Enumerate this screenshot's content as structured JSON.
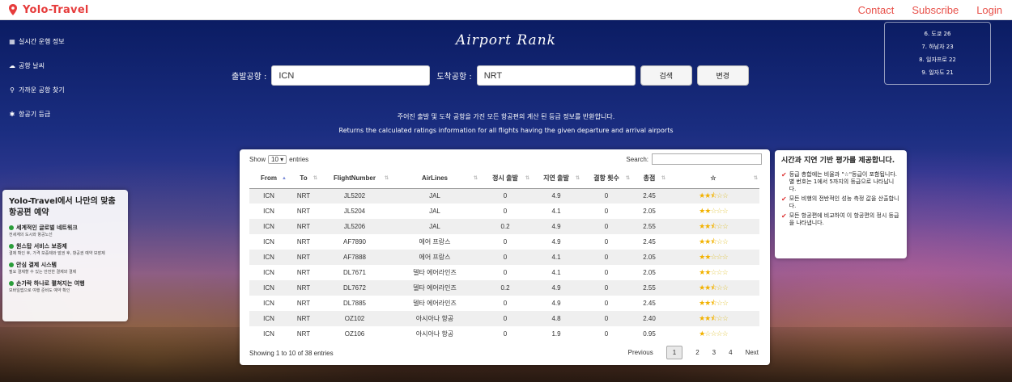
{
  "brand": {
    "name": "Yolo-Travel"
  },
  "nav": {
    "contact": "Contact",
    "subscribe": "Subscribe",
    "login": "Login"
  },
  "sidemenu": [
    {
      "icon": "card-icon",
      "label": "실시간 운행 정보"
    },
    {
      "icon": "cloud-icon",
      "label": "공항 날씨"
    },
    {
      "icon": "search-icon",
      "label": "가까운 공항 찾기"
    },
    {
      "icon": "star-icon",
      "label": "항공기 등급"
    }
  ],
  "title": "Airport Rank",
  "search": {
    "departure_label": "출발공항 :",
    "departure_value": "ICN",
    "arrival_label": "도착공항 :",
    "arrival_value": "NRT",
    "search_button": "검색",
    "swap_button": "변경"
  },
  "rank_box": [
    "6. 도쿄 26",
    "7. 하남자 23",
    "8. 일자프로 22",
    "9. 일자도 21"
  ],
  "description": {
    "korean": "주어진 출발 및 도착 공항을 가진 모든 항공편의 계산 된 등급 정보를 반환합니다.",
    "english": "Returns the calculated ratings information for all flights having the given departure and arrival airports"
  },
  "table": {
    "show_label": "Show",
    "entries_value": "10",
    "entries_label": "entries",
    "search_label": "Search:",
    "columns": [
      "From",
      "To",
      "FlightNumber",
      "AirLines",
      "정시 출발",
      "지연 출발",
      "결항 횟수",
      "총점",
      "☆"
    ],
    "rows": [
      {
        "from": "ICN",
        "to": "NRT",
        "flight": "JL5202",
        "airline": "JAL",
        "ontime": "0",
        "delay": "4.9",
        "cancel": "0",
        "score": "2.45",
        "stars": 2.5
      },
      {
        "from": "ICN",
        "to": "NRT",
        "flight": "JL5204",
        "airline": "JAL",
        "ontime": "0",
        "delay": "4.1",
        "cancel": "0",
        "score": "2.05",
        "stars": 2
      },
      {
        "from": "ICN",
        "to": "NRT",
        "flight": "JL5206",
        "airline": "JAL",
        "ontime": "0.2",
        "delay": "4.9",
        "cancel": "0",
        "score": "2.55",
        "stars": 2.5
      },
      {
        "from": "ICN",
        "to": "NRT",
        "flight": "AF7890",
        "airline": "에어 프랑스",
        "ontime": "0",
        "delay": "4.9",
        "cancel": "0",
        "score": "2.45",
        "stars": 2.5
      },
      {
        "from": "ICN",
        "to": "NRT",
        "flight": "AF7888",
        "airline": "에어 프랑스",
        "ontime": "0",
        "delay": "4.1",
        "cancel": "0",
        "score": "2.05",
        "stars": 2
      },
      {
        "from": "ICN",
        "to": "NRT",
        "flight": "DL7671",
        "airline": "델타 에어라인즈",
        "ontime": "0",
        "delay": "4.1",
        "cancel": "0",
        "score": "2.05",
        "stars": 2
      },
      {
        "from": "ICN",
        "to": "NRT",
        "flight": "DL7672",
        "airline": "델타 에어라인즈",
        "ontime": "0.2",
        "delay": "4.9",
        "cancel": "0",
        "score": "2.55",
        "stars": 2.5
      },
      {
        "from": "ICN",
        "to": "NRT",
        "flight": "DL7885",
        "airline": "델타 에어라인즈",
        "ontime": "0",
        "delay": "4.9",
        "cancel": "0",
        "score": "2.45",
        "stars": 2.5
      },
      {
        "from": "ICN",
        "to": "NRT",
        "flight": "OZ102",
        "airline": "아시아나 항공",
        "ontime": "0",
        "delay": "4.8",
        "cancel": "0",
        "score": "2.40",
        "stars": 2.5
      },
      {
        "from": "ICN",
        "to": "NRT",
        "flight": "OZ106",
        "airline": "아시아나 항공",
        "ontime": "0",
        "delay": "1.9",
        "cancel": "0",
        "score": "0.95",
        "stars": 1
      }
    ],
    "info": "Showing 1 to 10 of 38 entries",
    "pager": {
      "previous": "Previous",
      "pages": [
        "1",
        "2",
        "3",
        "4"
      ],
      "next": "Next"
    }
  },
  "right_card": {
    "heading": "시간과 지연 기반 평가를 제공합니다.",
    "items": [
      "등급 총합에는 비율과 \"☆\"등급이 포함됩니다. 별 번호는 1에서 5까지의 등급으로 나타납니다.",
      "모든 비행의 전반적인 성능 측정 값을 산출합니다.",
      "모든 항공편에 비교하여 이 항공편의 정시 등급을 나타냅니다."
    ]
  },
  "left_card": {
    "heading": "Yolo-Travel에서 나만의 맞춤 항공편 예약",
    "features": [
      {
        "title": "세계적인 글로벌 네트워크",
        "sub": "전세계의 도시와 항공노선"
      },
      {
        "title": "원스탑 서비스 보증제",
        "sub": "결제 확인 후, 가격 보증제와 발권 후, 항공권 예약 보장제"
      },
      {
        "title": "안심 결제 시스템",
        "sub": "필요 결제할 수 있는 안전한 결제와 결제"
      },
      {
        "title": "손가락 하나로 펼쳐지는 여행",
        "sub": "모바일앱으로 여행 준비도 예약 확인"
      }
    ]
  }
}
